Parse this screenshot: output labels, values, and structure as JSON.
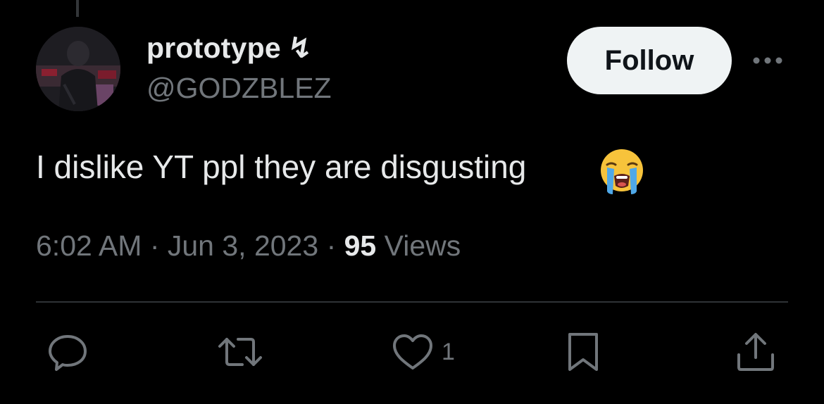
{
  "tweet": {
    "author": {
      "display_name": "prototype",
      "name_glyph": "↯",
      "handle": "@GODZBLEZ"
    },
    "follow_label": "Follow",
    "text": "I dislike YT ppl they are disgusting",
    "emoji": "loudly-crying-face",
    "meta": {
      "time": "6:02 AM",
      "separator1": " · ",
      "date": "Jun 3, 2023",
      "separator2": " · ",
      "views_count": "95",
      "views_label": " Views"
    },
    "actions": {
      "reply_icon": "speech-bubble-icon",
      "retweet_icon": "retweet-icon",
      "like_icon": "heart-icon",
      "like_count": "1",
      "bookmark_icon": "bookmark-icon",
      "share_icon": "share-icon"
    }
  },
  "colors": {
    "background": "#000000",
    "primary_text": "#e7e9ea",
    "secondary_text": "#71767b",
    "divider": "#2f3336",
    "follow_button_bg": "#eff3f4",
    "follow_button_text": "#0f1419"
  }
}
